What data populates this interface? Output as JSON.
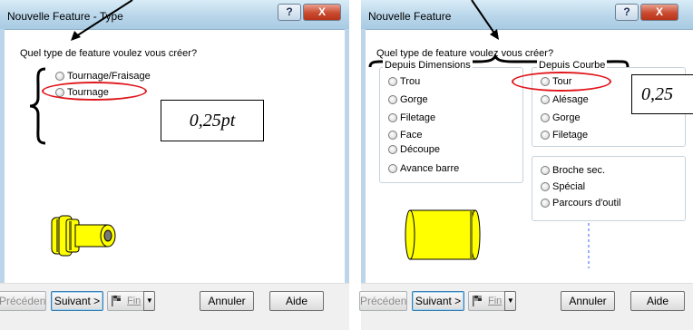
{
  "dialog1": {
    "title": "Nouvelle Feature - Type",
    "help_label": "?",
    "close_label": "X",
    "question": "Quel type de feature voulez vous créer?",
    "options": [
      "Tournage/Fraisage",
      "Tournage"
    ],
    "annotation": "0,25pt",
    "buttons": {
      "prev": "Précéden",
      "next": "Suivant >",
      "fin": "Fin",
      "cancel": "Annuler",
      "help": "Aide"
    }
  },
  "dialog2": {
    "title": "Nouvelle Feature",
    "help_label": "?",
    "close_label": "X",
    "question": "Quel type de feature voulez vous créer?",
    "group_dimensions": {
      "label": "Depuis Dimensions",
      "options": [
        "Trou",
        "Gorge",
        "Filetage",
        "Face",
        "Découpe",
        "Avance barre"
      ]
    },
    "group_courbe": {
      "label": "Depuis Courbe",
      "options": [
        "Tour",
        "Alésage",
        "Gorge",
        "Filetage"
      ]
    },
    "group_other": {
      "options": [
        "Broche sec.",
        "Spécial",
        "Parcours d'outil"
      ]
    },
    "annotation": "0,25",
    "buttons": {
      "prev": "Précéden",
      "next": "Suivant >",
      "fin": "Fin",
      "cancel": "Annuler",
      "help": "Aide"
    }
  },
  "icons": {
    "flag": "flag-icon",
    "dropdown": "chevron-down-icon",
    "part": "turned-part-icon",
    "arrow": "arrow-icon",
    "brace": "brace-icon"
  },
  "colors": {
    "annotation_red": "#e0161b",
    "part_yellow": "#ffff00",
    "close_red": "#c94a2f",
    "title_blue": "#b9d6ea"
  }
}
